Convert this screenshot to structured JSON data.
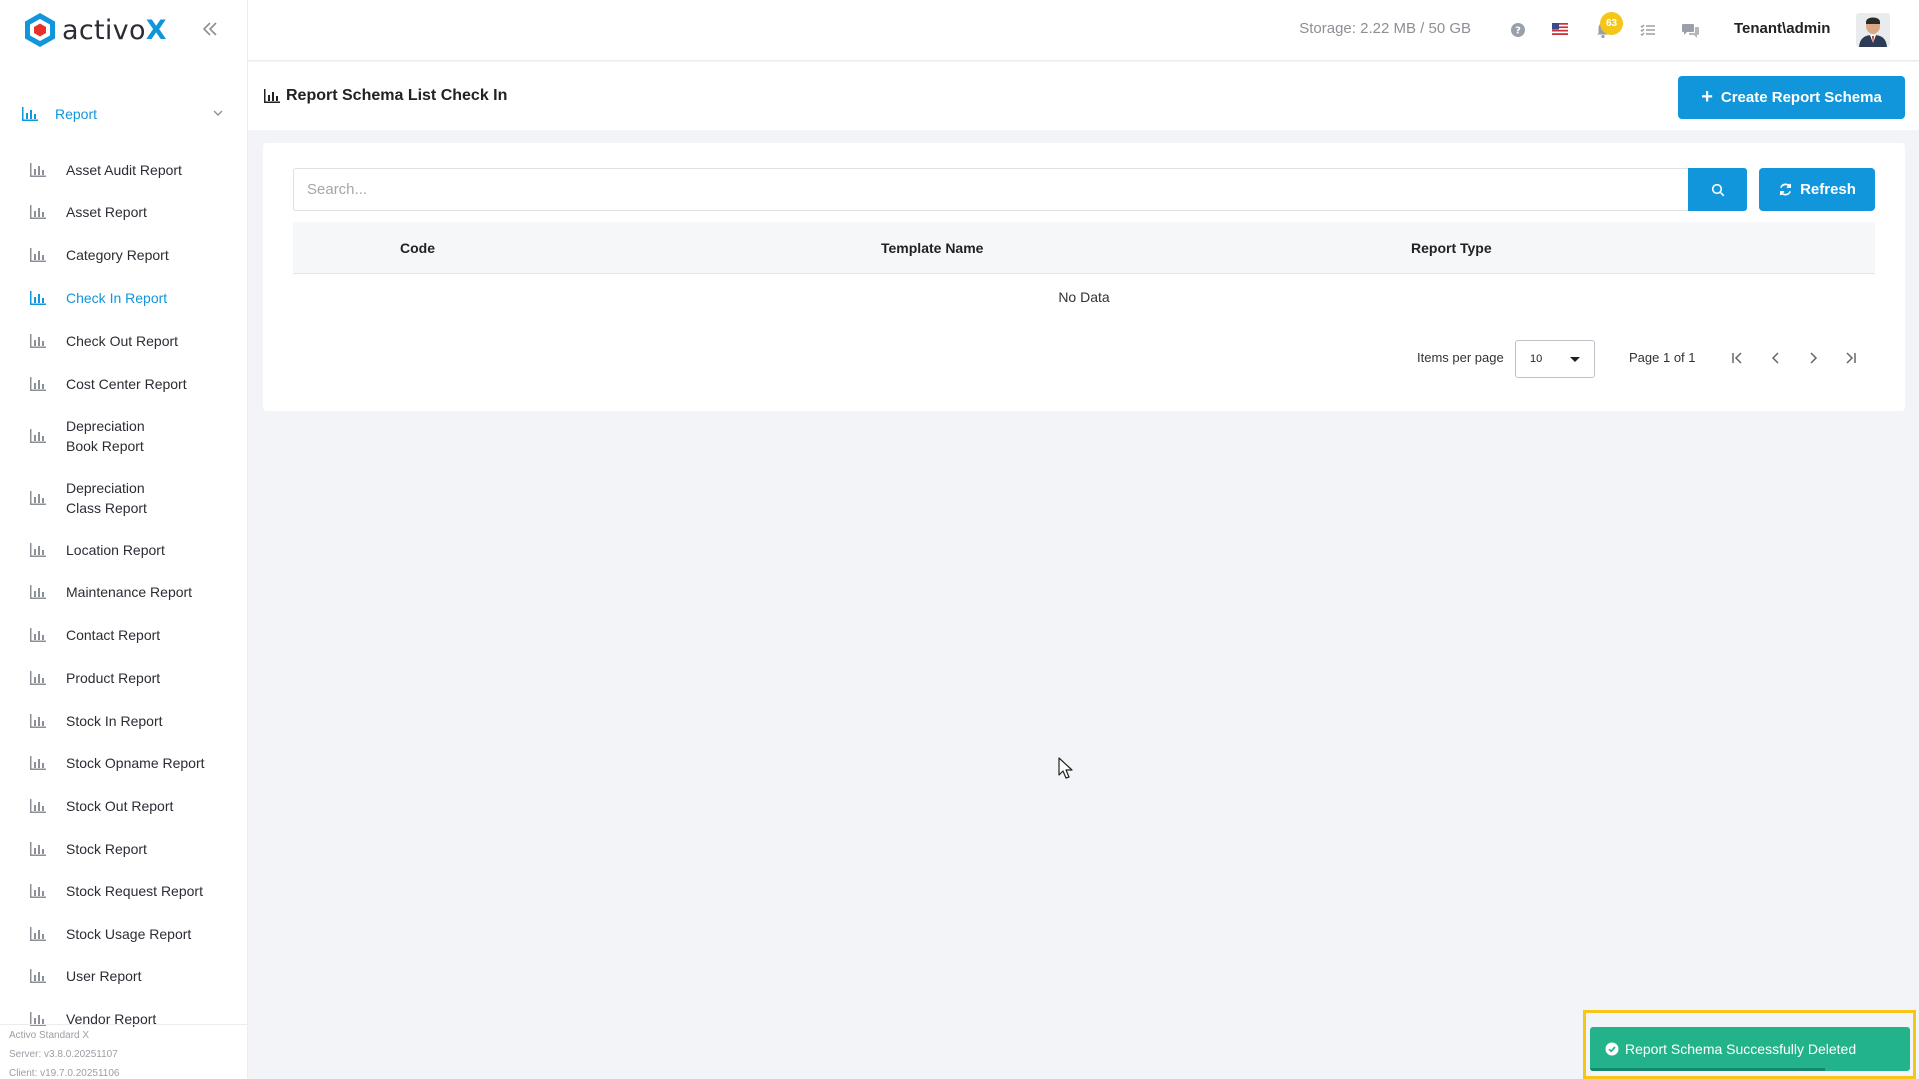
{
  "app": {
    "name": "activo",
    "name_x": "X"
  },
  "sidebar": {
    "group_label": "Report",
    "items": [
      {
        "label": "Asset Audit Report"
      },
      {
        "label": "Asset Report"
      },
      {
        "label": "Category Report"
      },
      {
        "label": "Check In Report",
        "active": true
      },
      {
        "label": "Check Out Report"
      },
      {
        "label": "Cost Center Report"
      },
      {
        "label": "Depreciation Book Report"
      },
      {
        "label": "Depreciation Class Report"
      },
      {
        "label": "Location Report"
      },
      {
        "label": "Maintenance Report"
      },
      {
        "label": "Contact Report"
      },
      {
        "label": "Product Report"
      },
      {
        "label": "Stock In Report"
      },
      {
        "label": "Stock Opname Report"
      },
      {
        "label": "Stock Out Report"
      },
      {
        "label": "Stock Report"
      },
      {
        "label": "Stock Request Report"
      },
      {
        "label": "Stock Usage Report"
      },
      {
        "label": "User Report"
      },
      {
        "label": "Vendor Report"
      }
    ],
    "version": {
      "edition": "Activo Standard X",
      "server": "Server: v3.8.0.20251107",
      "client": "Client: v19.7.0.20251106"
    }
  },
  "header": {
    "storage": "Storage: 2.22 MB / 50 GB",
    "notification_count": "63",
    "user": "Tenant\\admin"
  },
  "page": {
    "title": "Report Schema List Check In",
    "create_label": "Create Report Schema"
  },
  "table": {
    "search_placeholder": "Search...",
    "refresh_label": "Refresh",
    "columns": [
      "Code",
      "Template Name",
      "Report Type"
    ],
    "empty_text": "No Data",
    "items_per_page_label": "Items per page",
    "items_per_page": "10",
    "page_info": "Page 1 of 1"
  },
  "toast": {
    "message": "Report Schema Successfully Deleted",
    "color": "#23b38a"
  },
  "colors": {
    "accent": "#1296db",
    "badge": "#f5c518"
  }
}
